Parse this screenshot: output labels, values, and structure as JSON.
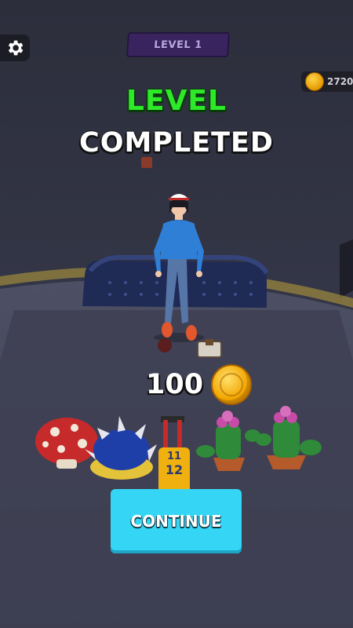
{
  "hud": {
    "level_label": "LEVEL 1",
    "coin_total": "2720"
  },
  "result": {
    "title_line1": "LEVEL",
    "title_line2": "COMPLETED",
    "reward_amount": "100"
  },
  "actions": {
    "continue_label": "CONTINUE"
  },
  "colors": {
    "accent_green": "#2ee82a",
    "button_cyan": "#35d6f5",
    "level_badge": "#3a2460"
  },
  "icons": [
    "gear-icon",
    "coin-icon"
  ]
}
